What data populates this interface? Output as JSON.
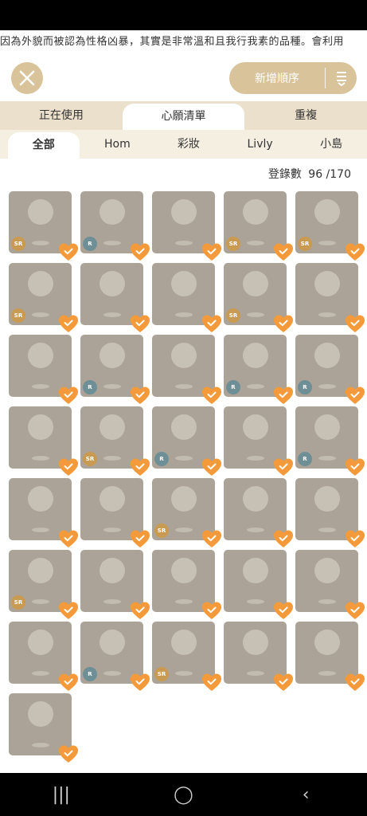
{
  "announcement": "因為外貌而被認為性格凶暴，其實是非常溫和且我行我素的品種。會利用",
  "toolbar": {
    "sort_label": "新增順序",
    "close_icon": "close-icon",
    "sort_icon": "sort-list-icon"
  },
  "tabs": [
    {
      "label": "正在使用"
    },
    {
      "label": "心願清單"
    },
    {
      "label": "重複"
    }
  ],
  "subtabs": [
    {
      "label": "全部"
    },
    {
      "label": "Hom"
    },
    {
      "label": "彩妝"
    },
    {
      "label": "Livly"
    },
    {
      "label": "小島"
    }
  ],
  "collection": {
    "label": "登錄數",
    "value": "96 /170"
  },
  "items": [
    {
      "name": "blue-eyes-face",
      "rarity": "SR"
    },
    {
      "name": "black-cat-hood",
      "rarity": "R"
    },
    {
      "name": "orange-dress",
      "rarity": ""
    },
    {
      "name": "yellow-hair",
      "rarity": "SR"
    },
    {
      "name": "brown-hair",
      "rarity": "SR"
    },
    {
      "name": "long-wavy-hair",
      "rarity": "SR"
    },
    {
      "name": "bob-hair",
      "rarity": ""
    },
    {
      "name": "green-frog",
      "rarity": ""
    },
    {
      "name": "white-feather",
      "rarity": "SR"
    },
    {
      "name": "ribbon-collar",
      "rarity": ""
    },
    {
      "name": "black-dress",
      "rarity": ""
    },
    {
      "name": "red-hood",
      "rarity": "R"
    },
    {
      "name": "white-outfit",
      "rarity": ""
    },
    {
      "name": "white-coat",
      "rarity": "R"
    },
    {
      "name": "black-hair",
      "rarity": "R"
    },
    {
      "name": "round-glasses",
      "rarity": ""
    },
    {
      "name": "blonde-braids",
      "rarity": "SR"
    },
    {
      "name": "orange-balloon",
      "rarity": "R"
    },
    {
      "name": "light-blue-dress",
      "rarity": ""
    },
    {
      "name": "white-braids",
      "rarity": "R"
    },
    {
      "name": "leaf-crown",
      "rarity": ""
    },
    {
      "name": "lily-branch",
      "rarity": ""
    },
    {
      "name": "pink-long-hair",
      "rarity": "SR"
    },
    {
      "name": "leaf-umbrella",
      "rarity": ""
    },
    {
      "name": "white-cape",
      "rarity": ""
    },
    {
      "name": "purple-hair",
      "rarity": "SR"
    },
    {
      "name": "teal-eyes-face",
      "rarity": ""
    },
    {
      "name": "pink-bow-head",
      "rarity": ""
    },
    {
      "name": "black-boots",
      "rarity": ""
    },
    {
      "name": "teal-jacket",
      "rarity": ""
    },
    {
      "name": "blue-sparkles",
      "rarity": ""
    },
    {
      "name": "lavender-hair",
      "rarity": "R"
    },
    {
      "name": "halo-outfit",
      "rarity": "SR"
    },
    {
      "name": "gold-trim-cape",
      "rarity": ""
    },
    {
      "name": "dark-vest",
      "rarity": ""
    },
    {
      "name": "sun-halo",
      "rarity": ""
    }
  ],
  "colors": {
    "accent": "#d9c39a",
    "heart": "#f49a3a",
    "card": "#aba397"
  }
}
